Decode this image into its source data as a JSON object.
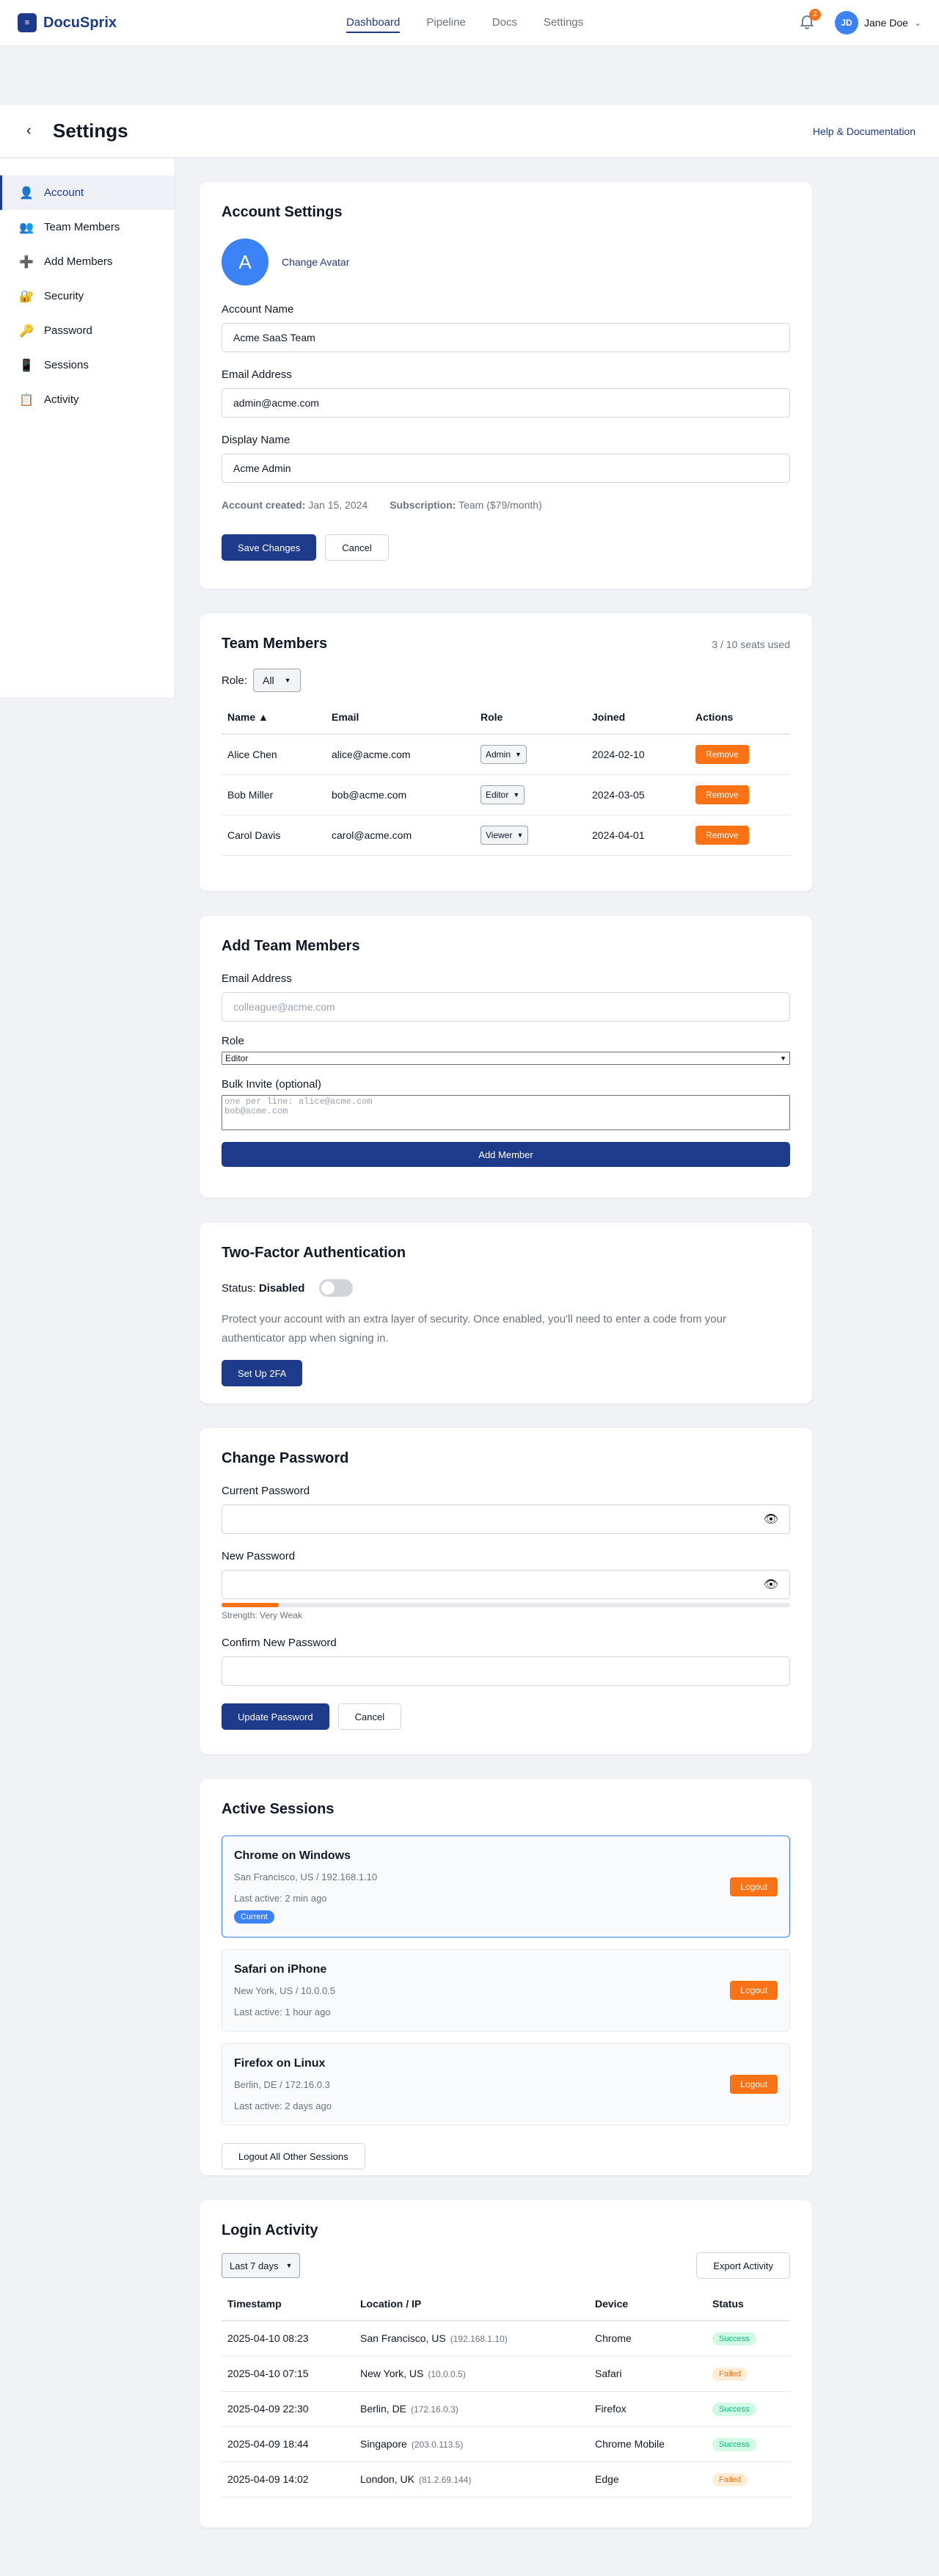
{
  "nav": {
    "logo_mark": "≡",
    "brand": "DocuSprix",
    "links": [
      "Dashboard",
      "Pipeline",
      "Docs",
      "Settings"
    ],
    "notification_count": "2",
    "user_initials": "JD",
    "user_name": "Jane Doe",
    "user_caret": "⌄"
  },
  "header": {
    "back": "‹",
    "title": "Settings",
    "help_link": "Help & Documentation"
  },
  "sidebar": {
    "items": [
      {
        "icon": "👤",
        "label": "Account"
      },
      {
        "icon": "👥",
        "label": "Team Members"
      },
      {
        "icon": "➕",
        "label": "Add Members"
      },
      {
        "icon": "🔐",
        "label": "Security"
      },
      {
        "icon": "🔑",
        "label": "Password"
      },
      {
        "icon": "📱",
        "label": "Sessions"
      },
      {
        "icon": "📋",
        "label": "Activity"
      }
    ]
  },
  "account": {
    "title": "Account Settings",
    "avatar_letter": "A",
    "change_avatar": "Change Avatar",
    "account_name_label": "Account Name",
    "account_name_value": "Acme SaaS Team",
    "email_label": "Email Address",
    "email_value": "admin@acme.com",
    "display_name_label": "Display Name",
    "display_name_value": "Acme Admin",
    "created_label": "Account created:",
    "created_value": "Jan 15, 2024",
    "subscription_label": "Subscription:",
    "subscription_value": "Team ($79/month)",
    "save": "Save Changes",
    "cancel": "Cancel"
  },
  "team": {
    "title": "Team Members",
    "seats": "3 / 10 seats used",
    "role_label": "Role:",
    "role_filter": "All",
    "columns": [
      "Name ▲",
      "Email",
      "Role",
      "Joined",
      "Actions"
    ],
    "rows": [
      {
        "name": "Alice Chen",
        "email": "alice@acme.com",
        "role": "Admin",
        "joined": "2024-02-10",
        "action": "Remove"
      },
      {
        "name": "Bob Miller",
        "email": "bob@acme.com",
        "role": "Editor",
        "joined": "2024-03-05",
        "action": "Remove"
      },
      {
        "name": "Carol Davis",
        "email": "carol@acme.com",
        "role": "Viewer",
        "joined": "2024-04-01",
        "action": "Remove"
      }
    ]
  },
  "add_members": {
    "title": "Add Team Members",
    "email_label": "Email Address",
    "email_placeholder": "colleague@acme.com",
    "role_label": "Role",
    "role_value": "Editor",
    "bulk_label": "Bulk Invite (optional)",
    "bulk_placeholder_1": "one per line: alice@acme.com",
    "bulk_placeholder_2": "bob@acme.com",
    "submit": "Add Member"
  },
  "twofa": {
    "title": "Two-Factor Authentication",
    "status_label": "Status:",
    "status_value": "Disabled",
    "description": "Protect your account with an extra layer of security. Once enabled, you'll need to enter a code from your authenticator app when signing in.",
    "setup": "Set Up 2FA"
  },
  "password": {
    "title": "Change Password",
    "current_label": "Current Password",
    "new_label": "New Password",
    "strength": "Strength: Very Weak",
    "strength_fraction": 0.1,
    "confirm_label": "Confirm New Password",
    "update": "Update Password",
    "cancel": "Cancel",
    "eye": "👁"
  },
  "sessions": {
    "title": "Active Sessions",
    "items": [
      {
        "device": "Chrome on Windows",
        "location": "San Francisco, US / 192.168.1.10",
        "active": "Last active: 2 min ago",
        "badge": "Current",
        "logout": "Logout"
      },
      {
        "device": "Safari on iPhone",
        "location": "New York, US / 10.0.0.5",
        "active": "Last active: 1 hour ago",
        "logout": "Logout"
      },
      {
        "device": "Firefox on Linux",
        "location": "Berlin, DE / 172.16.0.3",
        "active": "Last active: 2 days ago",
        "logout": "Logout"
      }
    ],
    "logout_all": "Logout All Other Sessions"
  },
  "activity": {
    "title": "Login Activity",
    "range": "Last 7 days",
    "export": "Export Activity",
    "columns": [
      "Timestamp",
      "Location / IP",
      "Device",
      "Status"
    ],
    "rows": [
      {
        "time": "2025-04-10 08:23",
        "location": "San Francisco, US",
        "ip": "(192.168.1.10)",
        "device": "Chrome",
        "status": "Success"
      },
      {
        "time": "2025-04-10 07:15",
        "location": "New York, US",
        "ip": "(10.0.0.5)",
        "device": "Safari",
        "status": "Failed"
      },
      {
        "time": "2025-04-09 22:30",
        "location": "Berlin, DE",
        "ip": "(172.16.0.3)",
        "device": "Firefox",
        "status": "Success"
      },
      {
        "time": "2025-04-09 18:44",
        "location": "Singapore",
        "ip": "(203.0.113.5)",
        "device": "Chrome Mobile",
        "status": "Success"
      },
      {
        "time": "2025-04-09 14:02",
        "location": "London, UK",
        "ip": "(81.2.69.144)",
        "device": "Edge",
        "status": "Failed"
      }
    ]
  },
  "colors": {
    "brand": "#1e3a8a",
    "accent": "#3b82f6",
    "danger": "#f97316",
    "success": "#10b981"
  }
}
